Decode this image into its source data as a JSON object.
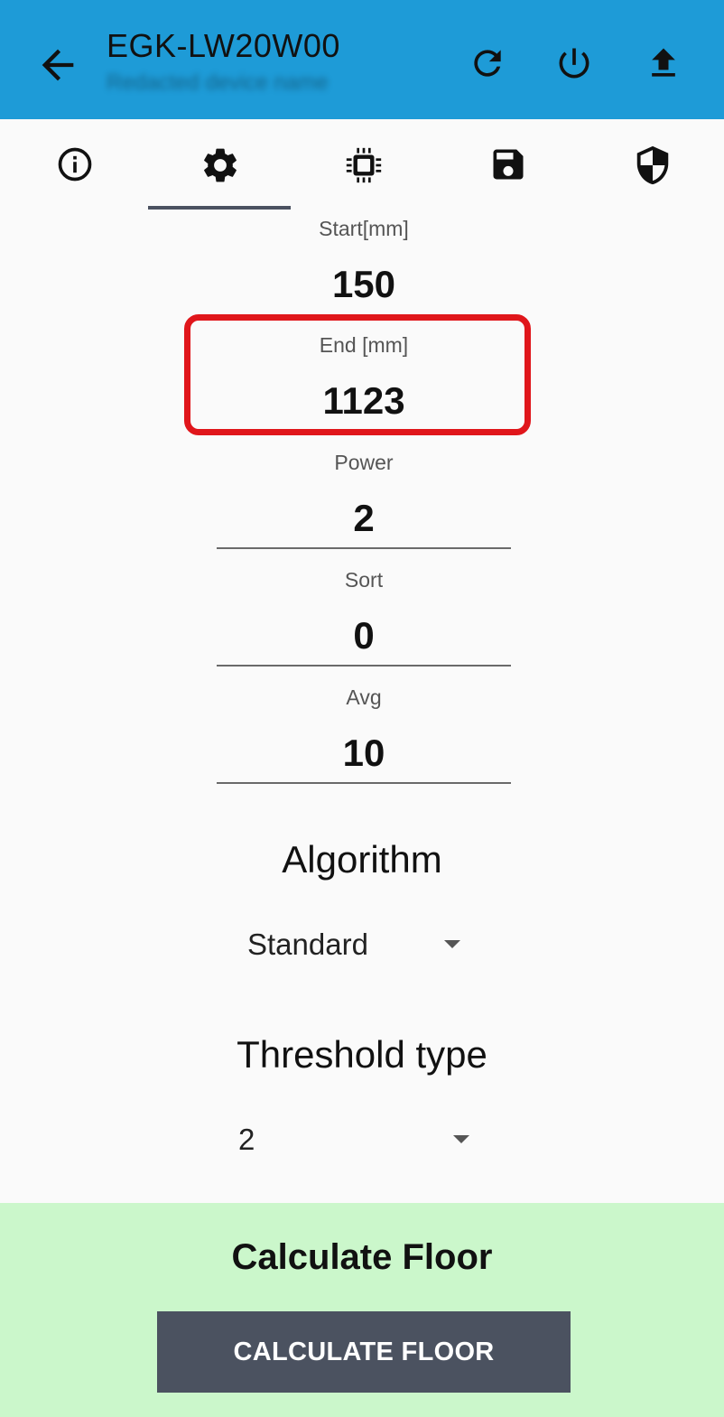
{
  "appbar": {
    "title": "EGK-LW20W00",
    "subtitle": "Redacted device name",
    "icons": [
      "back-arrow-icon",
      "refresh-icon",
      "power-icon",
      "upload-icon"
    ]
  },
  "tabs": [
    {
      "name": "info-icon"
    },
    {
      "name": "gear-icon",
      "selected": true
    },
    {
      "name": "chip-icon"
    },
    {
      "name": "save-icon"
    },
    {
      "name": "shield-icon"
    }
  ],
  "fields": {
    "start": {
      "label": "Start[mm]",
      "value": "150"
    },
    "end": {
      "label": "End [mm]",
      "value": "1123"
    },
    "power": {
      "label": "Power",
      "value": "2"
    },
    "sort": {
      "label": "Sort",
      "value": "0"
    },
    "avg": {
      "label": "Avg",
      "value": "10"
    }
  },
  "algorithm": {
    "title": "Algorithm",
    "selected": "Standard"
  },
  "threshold": {
    "title": "Threshold type",
    "selected": "2"
  },
  "calculate": {
    "heading": "Calculate Floor",
    "button_label": "CALCULATE FLOOR"
  },
  "colors": {
    "appbar": "#1e9bd7",
    "highlight": "#e0161b",
    "bottom_panel": "#cbf7cb",
    "button": "#4b5260"
  }
}
